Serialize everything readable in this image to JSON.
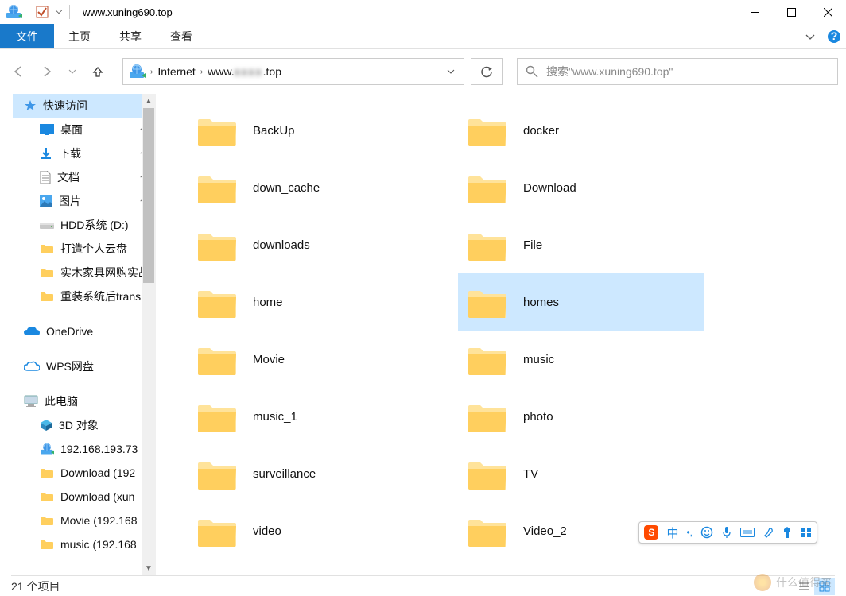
{
  "titlebar": {
    "title": "www.xuning690.top"
  },
  "ribbon": {
    "file": "文件",
    "home": "主页",
    "share": "共享",
    "view": "查看"
  },
  "address": {
    "crumb1": "Internet",
    "crumb2_prefix": "www.",
    "crumb2_blur": "xxxx",
    "crumb2_suffix": ".top"
  },
  "search": {
    "placeholder": "搜索\"www.xuning690.top\""
  },
  "sidebar": {
    "quick_access": "快速访问",
    "desktop": "桌面",
    "downloads": "下载",
    "documents": "文档",
    "pictures": "图片",
    "hdd": "HDD系统 (D:)",
    "cloud": "打造个人云盘",
    "furn": "实木家具网购实战",
    "reinstall": "重装系统后trans",
    "onedrive": "OneDrive",
    "wps": "WPS网盘",
    "thispc": "此电脑",
    "obj3d": "3D 对象",
    "ip": "192.168.193.73",
    "dl192": "Download (192",
    "dlxun": "Download (xun",
    "mov192": "Movie (192.168",
    "mus192": "music (192.168"
  },
  "folders": [
    {
      "name": "BackUp",
      "sel": false
    },
    {
      "name": "down_cache",
      "sel": false
    },
    {
      "name": "downloads",
      "sel": false
    },
    {
      "name": "home",
      "sel": false
    },
    {
      "name": "Movie",
      "sel": false
    },
    {
      "name": "music_1",
      "sel": false
    },
    {
      "name": "surveillance",
      "sel": false
    },
    {
      "name": "video",
      "sel": false
    },
    {
      "name": "docker",
      "sel": false
    },
    {
      "name": "Download",
      "sel": false
    },
    {
      "name": "File",
      "sel": false
    },
    {
      "name": "homes",
      "sel": true
    },
    {
      "name": "music",
      "sel": false
    },
    {
      "name": "photo",
      "sel": false
    },
    {
      "name": "TV",
      "sel": false
    },
    {
      "name": "Video_2",
      "sel": false
    }
  ],
  "status": {
    "count": "21 个项目"
  },
  "ime": {
    "lang": "中"
  },
  "watermark": {
    "text": "什么值得买"
  }
}
